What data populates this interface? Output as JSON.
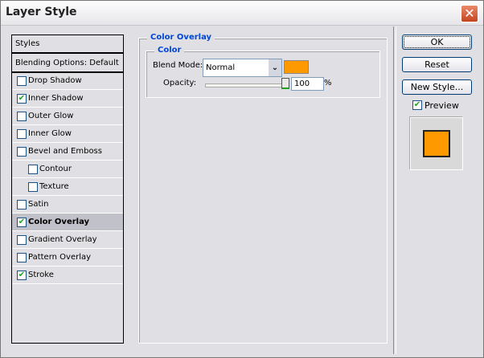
{
  "window": {
    "title": "Layer Style",
    "close": "✕"
  },
  "styles_list": {
    "header": "Styles",
    "blending": "Blending Options: Default",
    "items": [
      {
        "label": "Drop Shadow",
        "checked": false,
        "indent": false
      },
      {
        "label": "Inner Shadow",
        "checked": true,
        "indent": false
      },
      {
        "label": "Outer Glow",
        "checked": false,
        "indent": false
      },
      {
        "label": "Inner Glow",
        "checked": false,
        "indent": false
      },
      {
        "label": "Bevel and Emboss",
        "checked": false,
        "indent": false
      },
      {
        "label": "Contour",
        "checked": false,
        "indent": true
      },
      {
        "label": "Texture",
        "checked": false,
        "indent": true
      },
      {
        "label": "Satin",
        "checked": false,
        "indent": false
      },
      {
        "label": "Color Overlay",
        "checked": true,
        "indent": false,
        "selected": true
      },
      {
        "label": "Gradient Overlay",
        "checked": false,
        "indent": false
      },
      {
        "label": "Pattern Overlay",
        "checked": false,
        "indent": false
      },
      {
        "label": "Stroke",
        "checked": true,
        "indent": false
      }
    ]
  },
  "panel": {
    "title": "Color Overlay",
    "group": "Color",
    "blend_mode_label": "Blend Mode:",
    "blend_mode": "Normal",
    "color": "#ff9900",
    "opacity_label": "Opacity:",
    "opacity": "100",
    "percent": "%",
    "opacity_fraction": 1.0
  },
  "buttons": {
    "ok": "OK",
    "reset": "Reset",
    "new_style": "New Style...",
    "preview": "Preview",
    "preview_checked": true
  }
}
